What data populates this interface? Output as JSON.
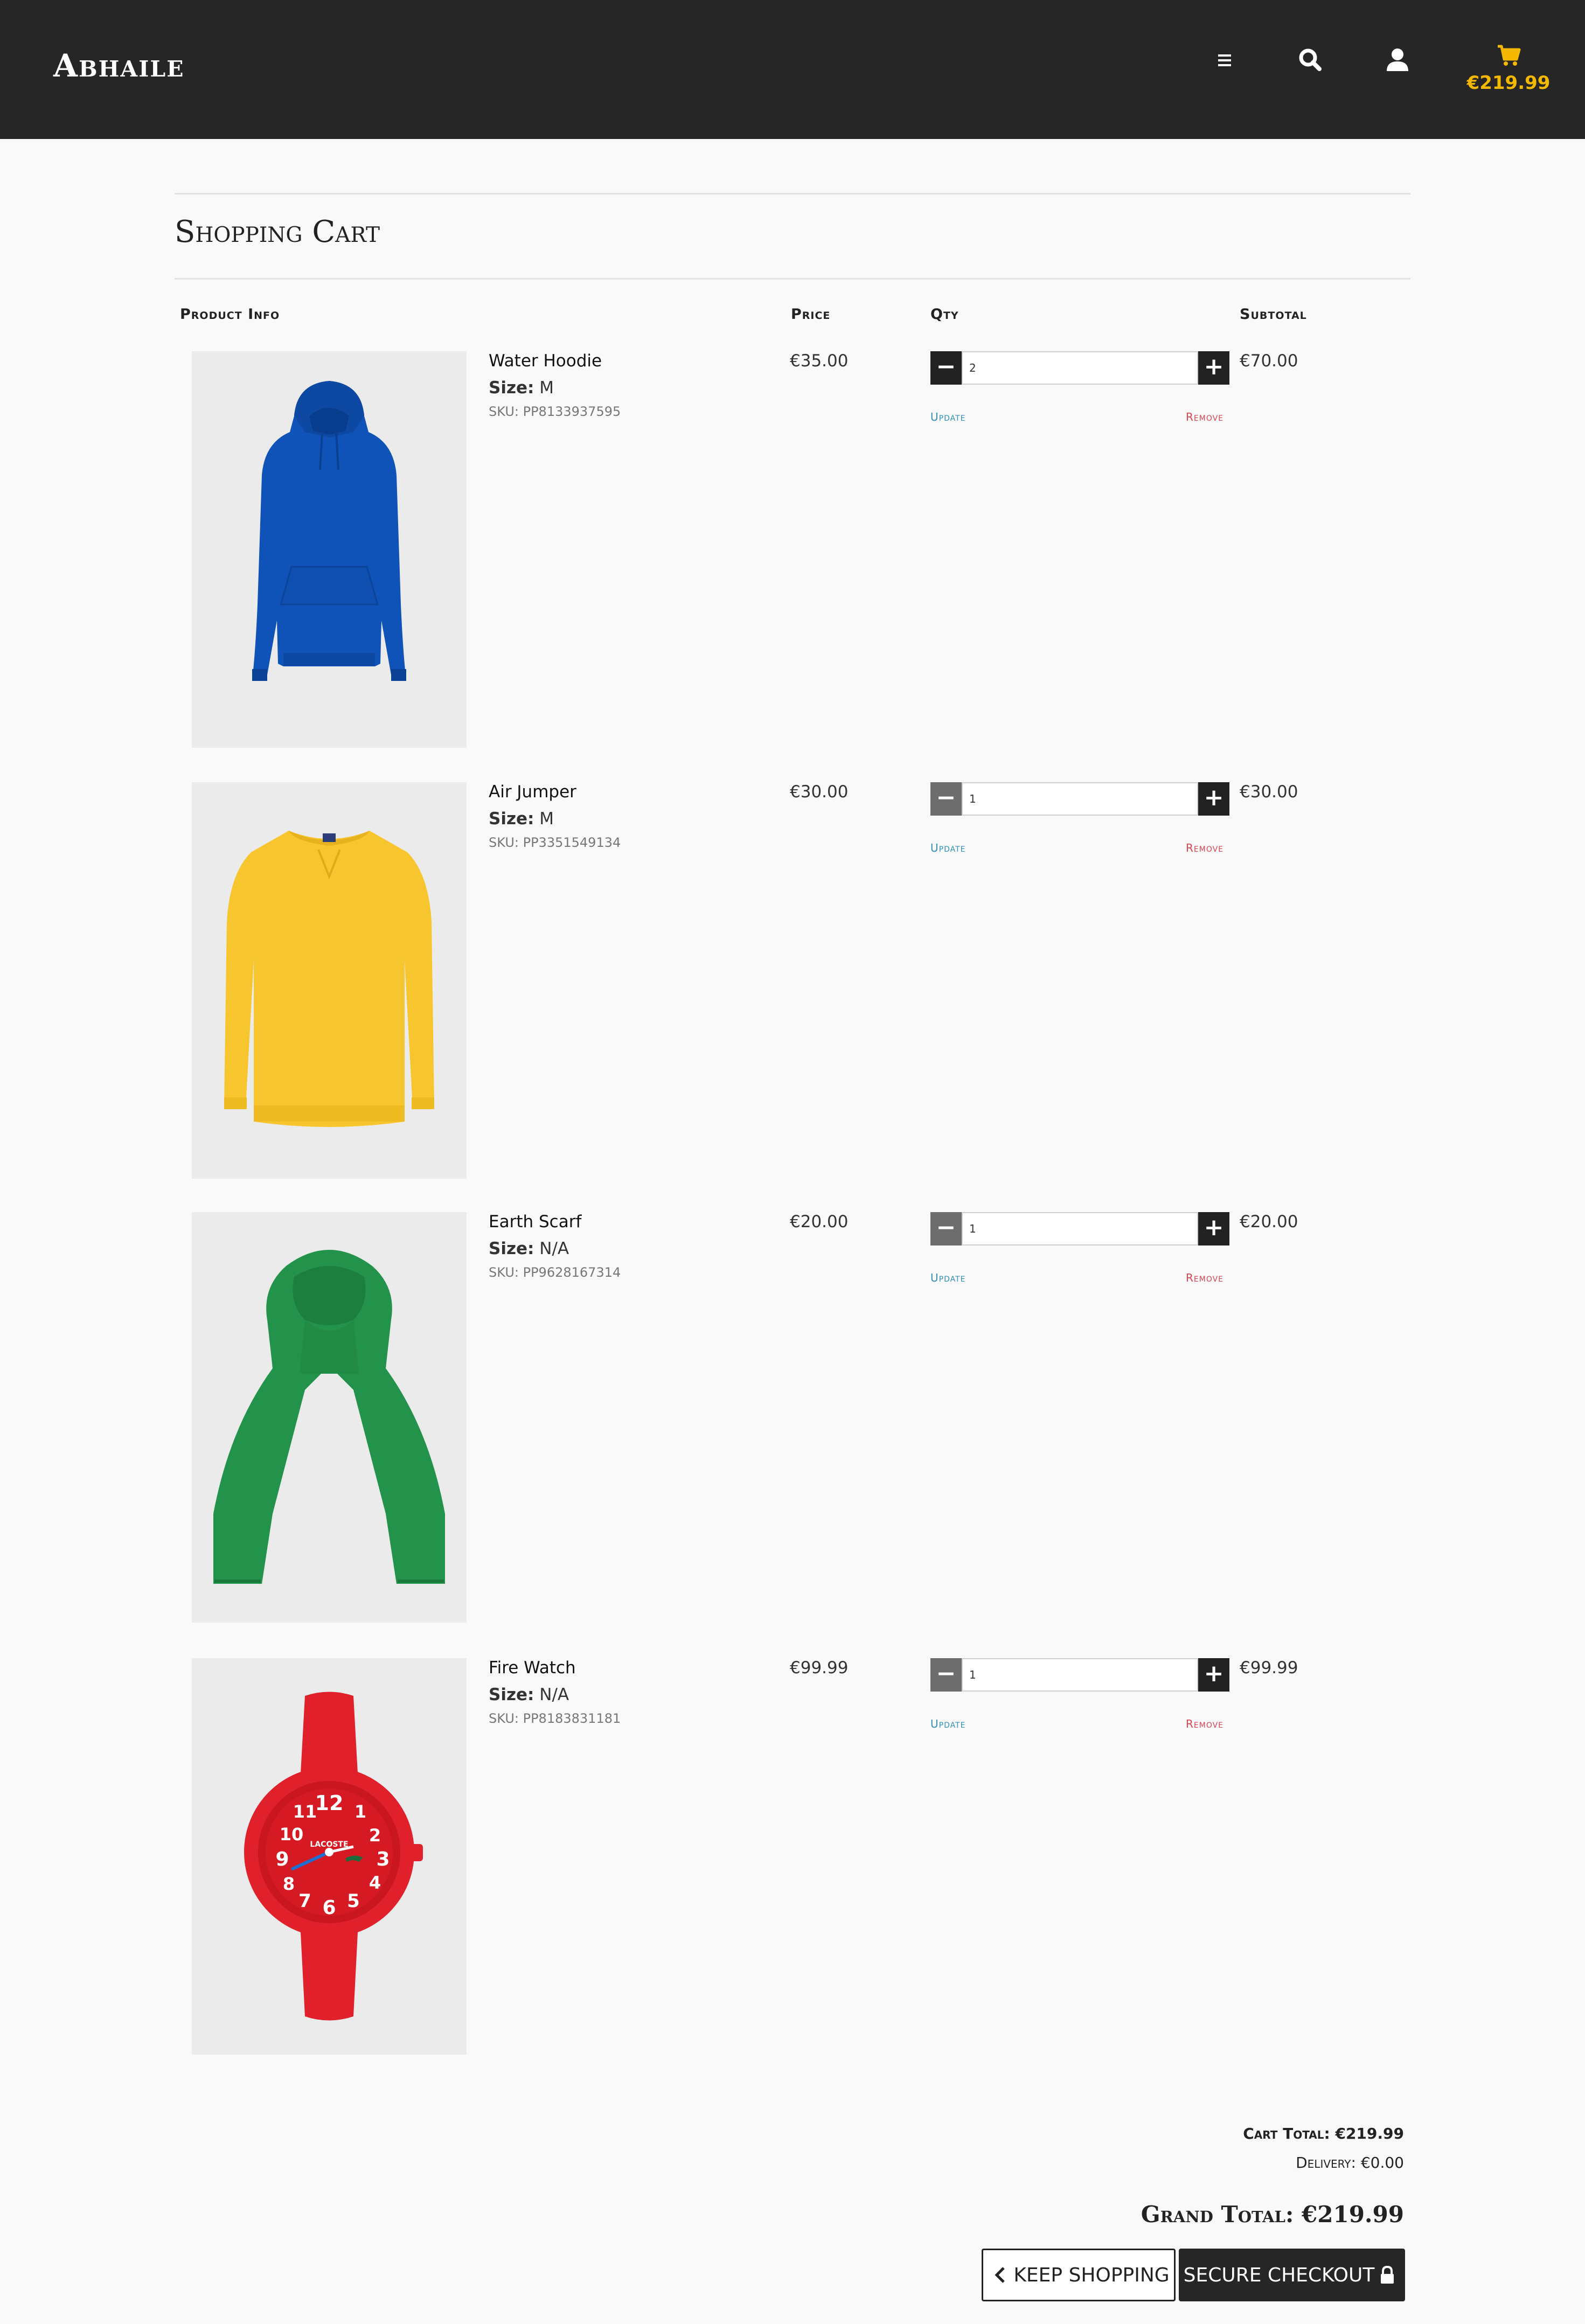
{
  "header": {
    "brand": "Abhaile",
    "cart_total": "€219.99",
    "icons": [
      "menu-icon",
      "search-icon",
      "account-icon",
      "cart-icon"
    ]
  },
  "page": {
    "title": "Shopping Cart"
  },
  "columns": {
    "product_info": "Product Info",
    "price": "Price",
    "qty": "Qty",
    "subtotal": "Subtotal"
  },
  "items": [
    {
      "name": "Water Hoodie",
      "size_label": "Size:",
      "size": "M",
      "sku": "SKU: PP8133937595",
      "price": "€35.00",
      "qty": "2",
      "subtotal": "€70.00",
      "update_label": "Update",
      "remove_label": "Remove",
      "image": "blue hoodie",
      "color": "#1053b8"
    },
    {
      "name": "Air Jumper",
      "size_label": "Size:",
      "size": "M",
      "sku": "SKU: PP3351549134",
      "price": "€30.00",
      "qty": "1",
      "subtotal": "€30.00",
      "update_label": "Update",
      "remove_label": "Remove",
      "image": "yellow jumper",
      "color": "#f7c62f"
    },
    {
      "name": "Earth Scarf",
      "size_label": "Size:",
      "size": "N/A",
      "sku": "SKU: PP9628167314",
      "price": "€20.00",
      "qty": "1",
      "subtotal": "€20.00",
      "update_label": "Update",
      "remove_label": "Remove",
      "image": "green scarf",
      "color": "#23924a"
    },
    {
      "name": "Fire Watch",
      "size_label": "Size:",
      "size": "N/A",
      "sku": "SKU: PP8183831181",
      "price": "€99.99",
      "qty": "1",
      "subtotal": "€99.99",
      "update_label": "Update",
      "remove_label": "Remove",
      "image": "red watch",
      "watch_brand": "LACOSTE",
      "color": "#e0202a"
    }
  ],
  "totals": {
    "cart_total": "Cart Total: €219.99",
    "delivery": "Delivery: €0.00",
    "grand_total": "Grand Total: €219.99"
  },
  "buttons": {
    "keep_shopping": "KEEP SHOPPING",
    "secure_checkout": "SECURE CHECKOUT"
  },
  "colors": {
    "header_bg": "#262626",
    "accent": "#f5b800",
    "update": "#2f8fb5",
    "remove": "#d9434f"
  }
}
